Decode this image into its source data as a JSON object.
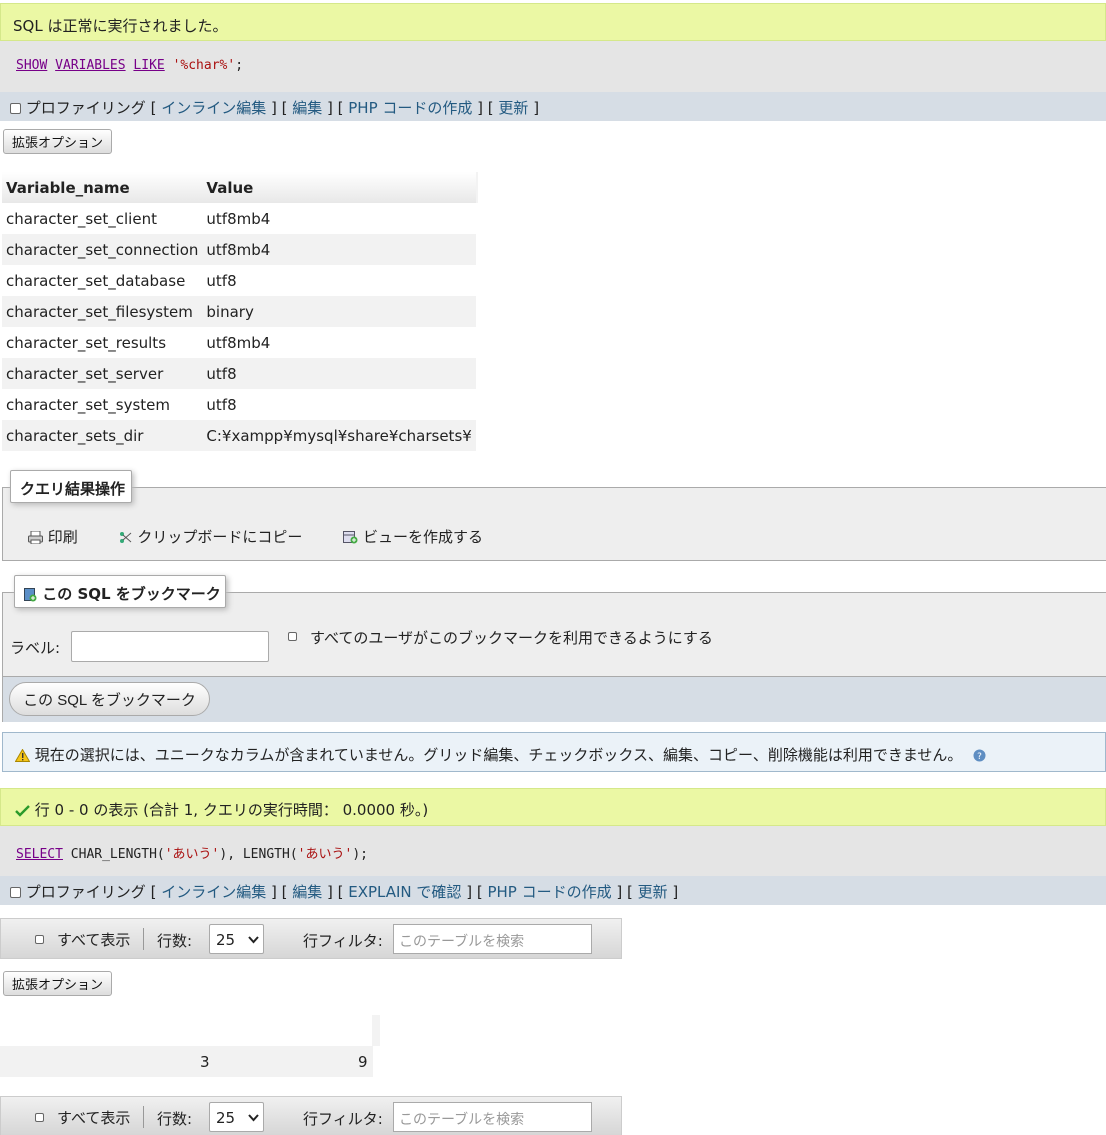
{
  "msg1": "SQL は正常に実行されました。",
  "sql1": {
    "kw1": "SHOW",
    "kw2": "VARIABLES",
    "kw3": "LIKE",
    "str": "'%char%'",
    "end": ";"
  },
  "tools1": {
    "profiling": "プロファイリング",
    "inline_edit": "インライン編集",
    "edit": "編集",
    "php": "PHP コードの作成",
    "refresh": "更新"
  },
  "ext_options": "拡張オプション",
  "table": {
    "headers": [
      "Variable_name",
      "Value"
    ],
    "rows": [
      [
        "character_set_client",
        "utf8mb4"
      ],
      [
        "character_set_connection",
        "utf8mb4"
      ],
      [
        "character_set_database",
        "utf8"
      ],
      [
        "character_set_filesystem",
        "binary"
      ],
      [
        "character_set_results",
        "utf8mb4"
      ],
      [
        "character_set_server",
        "utf8"
      ],
      [
        "character_set_system",
        "utf8"
      ],
      [
        "character_sets_dir",
        "C:¥xampp¥mysql¥share¥charsets¥"
      ]
    ]
  },
  "qops": {
    "legend": "クエリ結果操作",
    "print": "印刷",
    "copy": "クリップボードにコピー",
    "view": "ビューを作成する"
  },
  "bookmark": {
    "legend": "この SQL をブックマーク",
    "label": "ラベル:",
    "all_users": "すべてのユーザがこのブックマークを利用できるようにする",
    "button": "この SQL をブックマーク"
  },
  "warning": "現在の選択には、ユニークなカラムが含まれていません。グリッド編集、チェックボックス、編集、コピー、削除機能は利用できません。",
  "msg2": "行 0 - 0 の表示 (合計 1, クエリの実行時間： 0.0000 秒。)",
  "sql2": {
    "kw": "SELECT",
    "fn1": "CHAR_LENGTH(",
    "str1": "'あいう'",
    "mid": "), LENGTH(",
    "str2": "'あいう'",
    "end": ");"
  },
  "tools2": {
    "profiling": "プロファイリング",
    "inline_edit": "インライン編集",
    "edit": "編集",
    "explain": "EXPLAIN で確認",
    "php": "PHP コードの作成",
    "refresh": "更新"
  },
  "nav": {
    "show_all": "すべて表示",
    "rows_label": "行数:",
    "rows_value": "25",
    "filter_label": "行フィルタ:",
    "filter_placeholder": "このテーブルを検索"
  },
  "result2": {
    "v1": "3",
    "v2": "9"
  },
  "colors": {
    "success": "#ebf8a4",
    "link": "#235a81",
    "tools_bg": "#d6dde5",
    "sql_bg": "#e5e5e5"
  }
}
